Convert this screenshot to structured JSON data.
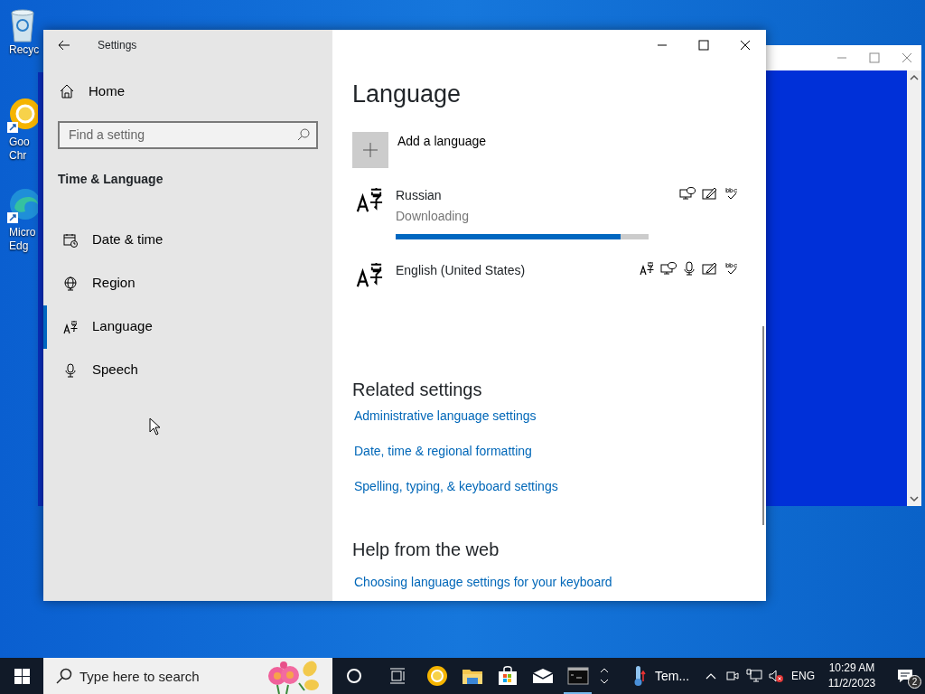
{
  "desktop_icons": [
    {
      "kind": "recycle",
      "lines": [
        "Recyc"
      ]
    },
    {
      "kind": "chrome",
      "lines": [
        "Goo",
        "Chr"
      ]
    },
    {
      "kind": "edge",
      "lines": [
        "Micro",
        "Edg"
      ]
    }
  ],
  "settings": {
    "title": "Settings",
    "nav": {
      "home": "Home",
      "search": {
        "placeholder": "Find a setting"
      },
      "section": "Time & Language",
      "items": [
        {
          "kind": "datetime",
          "label": "Date & time",
          "selected": false
        },
        {
          "kind": "region",
          "label": "Region",
          "selected": false
        },
        {
          "kind": "language",
          "label": "Language",
          "selected": true
        },
        {
          "kind": "speech",
          "label": "Speech",
          "selected": false
        }
      ]
    },
    "page_title": "Language",
    "add_language": "Add a language",
    "languages": [
      {
        "name": "Russian",
        "status": "Downloading",
        "level": 0.89,
        "features": [
          {
            "kind": "display"
          },
          {
            "kind": "handwriting"
          },
          {
            "kind": "spelling"
          }
        ]
      },
      {
        "name": "English (United States)",
        "features": [
          {
            "kind": "language"
          },
          {
            "kind": "display"
          },
          {
            "kind": "speech"
          },
          {
            "kind": "handwriting"
          },
          {
            "kind": "spelling"
          }
        ]
      }
    ],
    "related": {
      "heading": "Related settings",
      "links": [
        "Administrative language settings",
        "Date, time & regional formatting",
        "Spelling, typing, & keyboard settings"
      ]
    },
    "help": {
      "heading": "Help from the web",
      "links": [
        "Choosing language settings for your keyboard"
      ]
    }
  },
  "taskbar": {
    "search": {
      "placeholder": "Type here to search"
    },
    "apps": [
      {
        "kind": "cortana",
        "active": false
      },
      {
        "kind": "taskview",
        "active": false
      },
      {
        "kind": "chrome",
        "active": false
      },
      {
        "kind": "explorer",
        "active": false
      },
      {
        "kind": "store",
        "active": false
      },
      {
        "kind": "mail",
        "active": false
      },
      {
        "kind": "terminal",
        "active": true
      }
    ],
    "weather": "Tem...",
    "language": "ENG",
    "time": "10:29 AM",
    "date": "11/2/2023",
    "notifications": "2"
  }
}
